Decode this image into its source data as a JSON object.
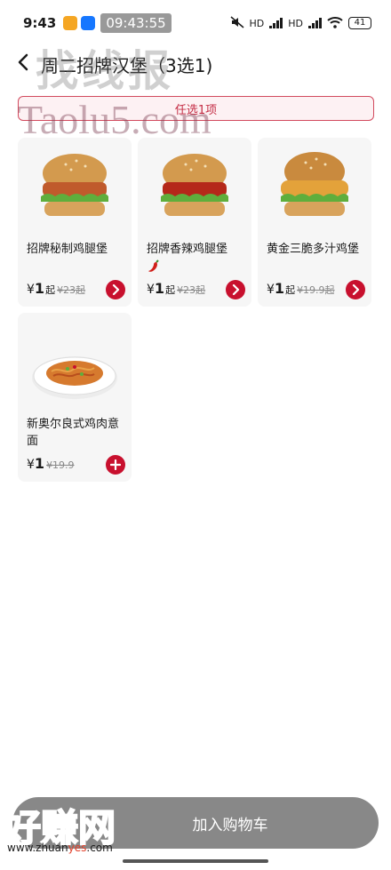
{
  "status_bar": {
    "time": "9:43",
    "clock_overlay": "09:43:55",
    "battery": "41",
    "network_labels": [
      "HD",
      "HD"
    ]
  },
  "header": {
    "title": "周二招牌汉堡（3选1)"
  },
  "watermarks": {
    "top": "找线报",
    "middle": "Taolu5.com",
    "bottom": "好赚网",
    "url_prefix": "www.zhuan",
    "url_highlight": "yes",
    "url_suffix": ".com"
  },
  "banner": {
    "label": "任选1项"
  },
  "products": [
    {
      "name": "招牌秘制鸡腿堡",
      "currency": "¥",
      "price": "1",
      "price_suffix": "起",
      "original_price": "¥23起",
      "action": "chevron",
      "spicy": false,
      "image_icon": "burger-chicken-icon"
    },
    {
      "name": "招牌香辣鸡腿堡",
      "currency": "¥",
      "price": "1",
      "price_suffix": "起",
      "original_price": "¥23起",
      "action": "chevron",
      "spicy": true,
      "image_icon": "burger-spicy-icon"
    },
    {
      "name": "黄金三脆多汁鸡堡",
      "currency": "¥",
      "price": "1",
      "price_suffix": "起",
      "original_price": "¥19.9起",
      "action": "chevron",
      "spicy": false,
      "image_icon": "burger-crispy-icon"
    },
    {
      "name": "新奥尔良式鸡肉意面",
      "currency": "¥",
      "price": "1",
      "price_suffix": "",
      "original_price": "¥19.9",
      "action": "plus",
      "spicy": false,
      "image_icon": "pasta-icon"
    }
  ],
  "cart": {
    "label": "加入购物车"
  },
  "colors": {
    "accent": "#c8102e",
    "banner_bg": "#fdf1f3",
    "card_bg": "#f6f6f6",
    "cart_bar": "#888888"
  }
}
